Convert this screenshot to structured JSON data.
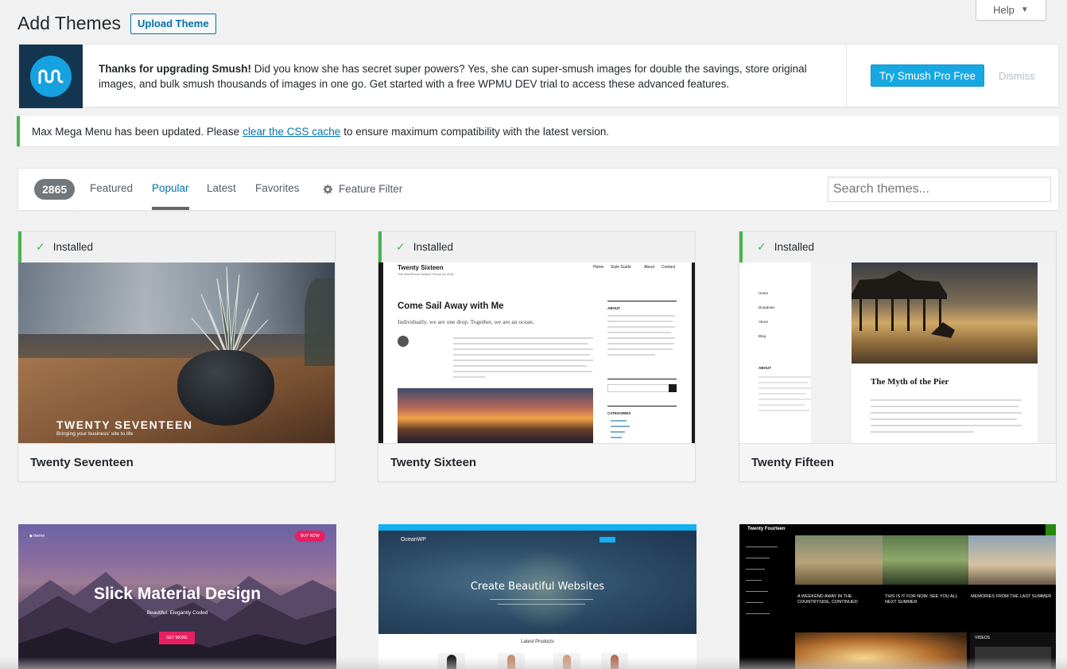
{
  "help": {
    "label": "Help"
  },
  "header": {
    "title": "Add Themes",
    "upload_label": "Upload Theme"
  },
  "smush_notice": {
    "bold": "Thanks for upgrading Smush!",
    "text": " Did you know she has secret super powers? Yes, she can super-smush images for double the savings, store original images, and bulk smush thousands of images in one go. Get started with a free WPMU DEV trial to access these advanced features.",
    "cta_label": "Try Smush Pro Free",
    "dismiss_label": "Dismiss"
  },
  "mega_notice": {
    "before": "Max Mega Menu has been updated. Please",
    "link": "clear the CSS cache",
    "after": "to ensure maximum compatibility with the latest version."
  },
  "filter": {
    "count": "2865",
    "tabs": [
      "Featured",
      "Popular",
      "Latest",
      "Favorites"
    ],
    "active_tab": "Popular",
    "feature_filter": "Feature Filter",
    "search_placeholder": "Search themes..."
  },
  "themes": [
    {
      "name": "Twenty Seventeen",
      "installed": "Installed",
      "shot_title": "TWENTY SEVENTEEN",
      "shot_tagline": "Bringing your business' site to life"
    },
    {
      "name": "Twenty Sixteen",
      "installed": "Installed",
      "shot_site": "Twenty Sixteen",
      "shot_tag": "The WordPress Default Theme for 2016",
      "shot_nav": [
        "Home",
        "Style Guide",
        "About",
        "Contact"
      ],
      "shot_heading": "Come Sail Away with Me",
      "shot_sub": "Individually, we are one drop. Together, we are an ocean.",
      "shot_about": "ABOUT",
      "shot_categories": "CATEGORIES"
    },
    {
      "name": "Twenty Fifteen",
      "installed": "Installed",
      "shot_heading": "The Myth of the Pier",
      "shot_nav": [
        "Home",
        "Dropdown",
        "About",
        "Blog"
      ],
      "shot_about": "ABOUT"
    },
    {
      "shot_title": "Slick Material Design",
      "shot_sub": "Beautiful. Elegantly Coded",
      "shot_btn": "GET MORE",
      "shot_nav_btn": "BUY NOW"
    },
    {
      "shot_logo": "OceanWP",
      "shot_title": "Create Beautiful Websites",
      "shot_products": "Latest Products"
    },
    {
      "shot_site": "Twenty Fourteen",
      "shot_caps": [
        "A WEEKEND AWAY IN THE COUNTRYSIDE, CONTINUED",
        "THIS IS IT FOR NOW. SEE YOU ALL NEXT SUMMER",
        "MEMORIES FROM THE LAST SUMMER"
      ],
      "shot_videos": "VIDEOS"
    }
  ],
  "colors": {
    "accent": "#0073aa",
    "installed_green": "#46b450",
    "smush_blue": "#17a8e3"
  }
}
